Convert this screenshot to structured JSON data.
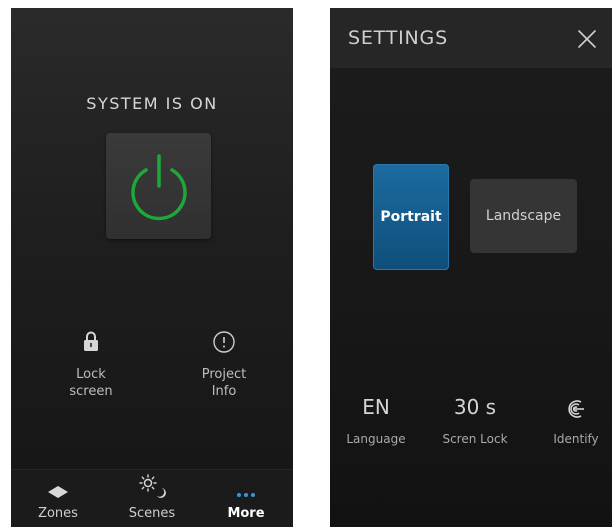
{
  "left_panel": {
    "system_status": "SYSTEM IS ON",
    "actions": [
      {
        "label": "Lock\nscreen",
        "icon": "lock-icon"
      },
      {
        "label": "Project\nInfo",
        "icon": "info-icon"
      }
    ],
    "tabs": [
      {
        "label": "Zones",
        "icon": "zones-icon",
        "active": false
      },
      {
        "label": "Scenes",
        "icon": "scenes-icon",
        "active": false
      },
      {
        "label": "More",
        "icon": "more-icon",
        "active": true
      }
    ]
  },
  "settings_panel": {
    "title": "SETTINGS",
    "orientation": {
      "portrait_label": "Portrait",
      "landscape_label": "Landscape",
      "selected": "Portrait"
    },
    "options": [
      {
        "value": "EN",
        "label": "Language"
      },
      {
        "value": "30 s",
        "label": "Scren Lock"
      },
      {
        "value": "",
        "label": "Identify",
        "icon": "identify-icon"
      }
    ]
  },
  "colors": {
    "power_on": "#1fa83a",
    "accent_blue": "#1a6aa0",
    "more_tab_icon": "#2e9ad6"
  }
}
